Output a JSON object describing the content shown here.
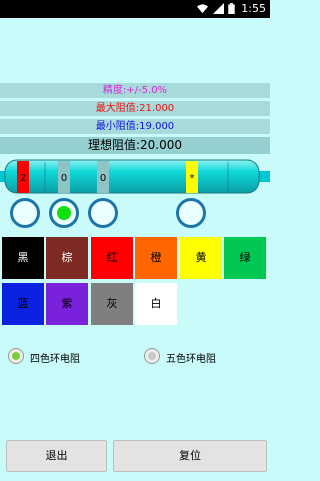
{
  "statusbar": {
    "time": "1:55"
  },
  "info": {
    "tolerance": "精度:+/-5.0%",
    "max": "最大阻值:21.000",
    "min": "最小阻值:19.000",
    "ideal": "理想阻值:20.000"
  },
  "resistor": {
    "bands": [
      {
        "label": "2",
        "color": "#ff0000"
      },
      {
        "label": "0",
        "color": "#8fc4c4"
      },
      {
        "label": "0",
        "color": "#8fc4c4"
      },
      {
        "label": "*",
        "color": "#ffff00"
      }
    ]
  },
  "band_selector": {
    "selected_index": 1
  },
  "colors": [
    {
      "label": "黑",
      "bg": "#000000",
      "fg": "#ffffff"
    },
    {
      "label": "棕",
      "bg": "#7d2a24",
      "fg": "#ffffff"
    },
    {
      "label": "红",
      "bg": "#ff0000",
      "fg": "#000000"
    },
    {
      "label": "橙",
      "bg": "#ff6600",
      "fg": "#000000"
    },
    {
      "label": "黄",
      "bg": "#ffff00",
      "fg": "#000000"
    },
    {
      "label": "绿",
      "bg": "#00c853",
      "fg": "#000000"
    },
    {
      "label": "蓝",
      "bg": "#0b22e0",
      "fg": "#000000"
    },
    {
      "label": "紫",
      "bg": "#7a21dc",
      "fg": "#000000"
    },
    {
      "label": "灰",
      "bg": "#7f7f7f",
      "fg": "#000000"
    },
    {
      "label": "白",
      "bg": "#ffffff",
      "fg": "#000000"
    }
  ],
  "mode": {
    "four": "四色环电阻",
    "five": "五色环电阻",
    "selected": "four"
  },
  "buttons": {
    "exit": "退出",
    "reset": "复位"
  }
}
